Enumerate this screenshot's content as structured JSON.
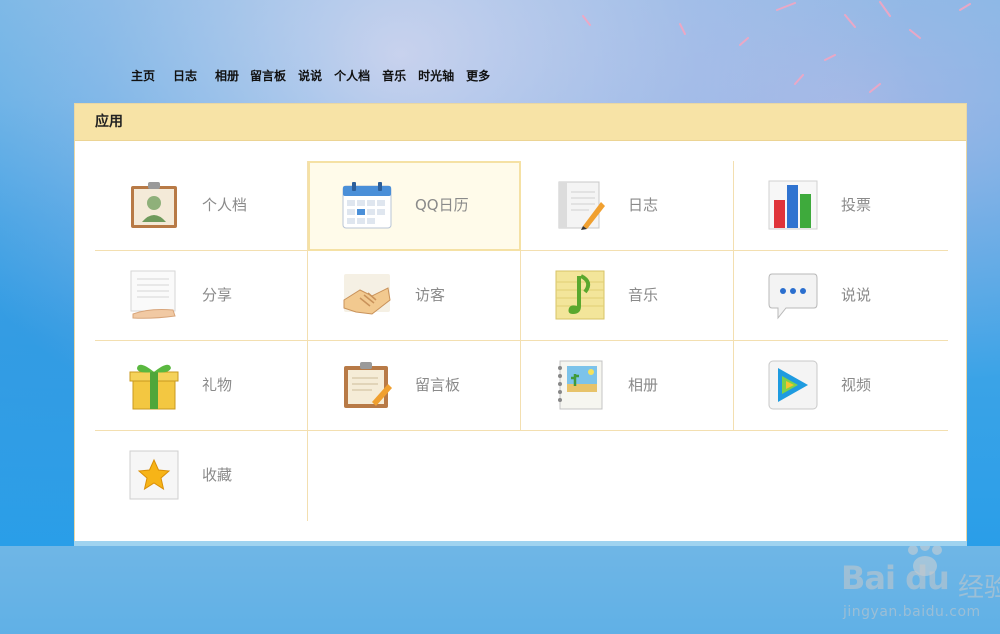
{
  "nav": {
    "items": [
      "主页",
      "日志",
      "相册",
      "留言板",
      "说说",
      "个人档",
      "音乐",
      "时光轴",
      "更多"
    ]
  },
  "panel": {
    "title": "应用",
    "apps": [
      {
        "label": "个人档",
        "icon": "profile-card-icon"
      },
      {
        "label": "QQ日历",
        "icon": "calendar-icon",
        "highlighted": true
      },
      {
        "label": "日志",
        "icon": "diary-book-icon"
      },
      {
        "label": "投票",
        "icon": "bar-chart-icon"
      },
      {
        "label": "分享",
        "icon": "share-hand-icon"
      },
      {
        "label": "访客",
        "icon": "handshake-icon"
      },
      {
        "label": "音乐",
        "icon": "music-note-icon"
      },
      {
        "label": "说说",
        "icon": "speech-bubble-icon"
      },
      {
        "label": "礼物",
        "icon": "gift-box-icon"
      },
      {
        "label": "留言板",
        "icon": "clipboard-pencil-icon"
      },
      {
        "label": "相册",
        "icon": "photo-album-icon"
      },
      {
        "label": "视频",
        "icon": "video-play-icon"
      },
      {
        "label": "收藏",
        "icon": "star-icon"
      }
    ]
  },
  "watermark": {
    "logo": "Bai du",
    "suffix": "经验",
    "url": "jingyan.baidu.com"
  },
  "colors": {
    "panel_header": "#f7e3a6",
    "grid_line": "#f3dfb0",
    "label": "#8a8a8a"
  }
}
